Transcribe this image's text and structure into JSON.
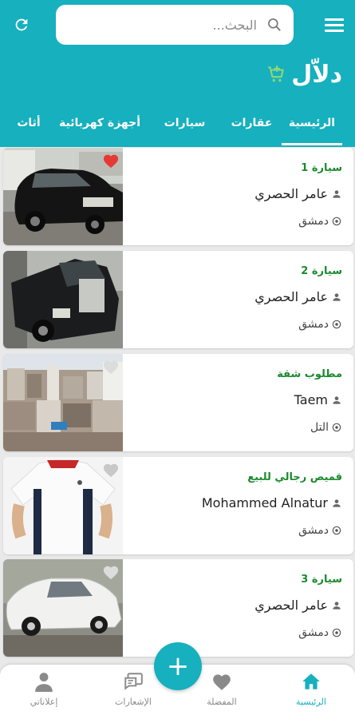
{
  "search": {
    "placeholder": "البحث..."
  },
  "header": {
    "brand": "دلاّل"
  },
  "tabs": [
    {
      "label": "الرئيسية",
      "active": true
    },
    {
      "label": "عقارات"
    },
    {
      "label": "سيارات"
    },
    {
      "label": "أجهزة كهربائية"
    },
    {
      "label": "أثاث"
    }
  ],
  "ads": [
    {
      "title": "سيارة 1",
      "user": "عامر الحصري",
      "location": "دمشق",
      "favorited": true,
      "image": "black-sedan-photo"
    },
    {
      "title": "سيارة 2",
      "user": "عامر الحصري",
      "location": "دمشق",
      "favorited": false,
      "image": "mercedes-photo"
    },
    {
      "title": "مطلوب شقة",
      "user": "Taem",
      "location": "التل",
      "favorited": false,
      "image": "city-buildings-photo"
    },
    {
      "title": "قميص رجالي للبيع",
      "user": "Mohammed Alnatur",
      "location": "دمشق",
      "favorited": false,
      "image": "white-polo-shirt-photo"
    },
    {
      "title": "سيارة 3",
      "user": "عامر الحصري",
      "location": "دمشق",
      "favorited": false,
      "image": "white-sedan-photo"
    }
  ],
  "bottom_nav": {
    "home": "الرئيسية",
    "favorites": "المفضلة",
    "notifications": "الإشعارات",
    "my_ads": "إعلاناتي"
  },
  "fab": {
    "symbol": "+"
  },
  "colors": {
    "primary": "#16b0be",
    "title_green": "#1a8a2e",
    "favorite_red": "#e53935",
    "cart_green": "#8bd67a"
  }
}
